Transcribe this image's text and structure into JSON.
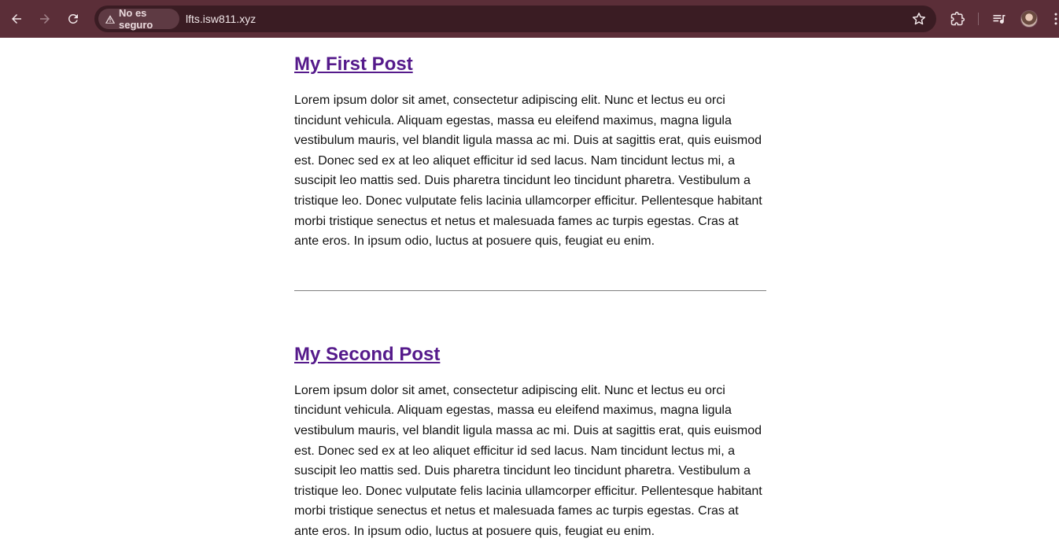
{
  "browser": {
    "security_label": "No es seguro",
    "url": "lfts.isw811.xyz",
    "theme_color": "#5b2e38"
  },
  "posts": [
    {
      "title": "My First Post",
      "body": "Lorem ipsum dolor sit amet, consectetur adipiscing elit. Nunc et lectus eu orci tincidunt vehicula. Aliquam egestas, massa eu eleifend maximus, magna ligula vestibulum mauris, vel blandit ligula massa ac mi. Duis at sagittis erat, quis euismod est. Donec sed ex at leo aliquet efficitur id sed lacus. Nam tincidunt lectus mi, a suscipit leo mattis sed. Duis pharetra tincidunt leo tincidunt pharetra. Vestibulum a tristique leo. Donec vulputate felis lacinia ullamcorper efficitur. Pellentesque habitant morbi tristique senectus et netus et malesuada fames ac turpis egestas. Cras at ante eros. In ipsum odio, luctus at posuere quis, feugiat eu enim."
    },
    {
      "title": "My Second Post",
      "body": "Lorem ipsum dolor sit amet, consectetur adipiscing elit. Nunc et lectus eu orci tincidunt vehicula. Aliquam egestas, massa eu eleifend maximus, magna ligula vestibulum mauris, vel blandit ligula massa ac mi. Duis at sagittis erat, quis euismod est. Donec sed ex at leo aliquet efficitur id sed lacus. Nam tincidunt lectus mi, a suscipit leo mattis sed. Duis pharetra tincidunt leo tincidunt pharetra. Vestibulum a tristique leo. Donec vulputate felis lacinia ullamcorper efficitur. Pellentesque habitant morbi tristique senectus et netus et malesuada fames ac turpis egestas. Cras at ante eros. In ipsum odio, luctus at posuere quis, feugiat eu enim."
    }
  ],
  "link_color": "#551a8b"
}
